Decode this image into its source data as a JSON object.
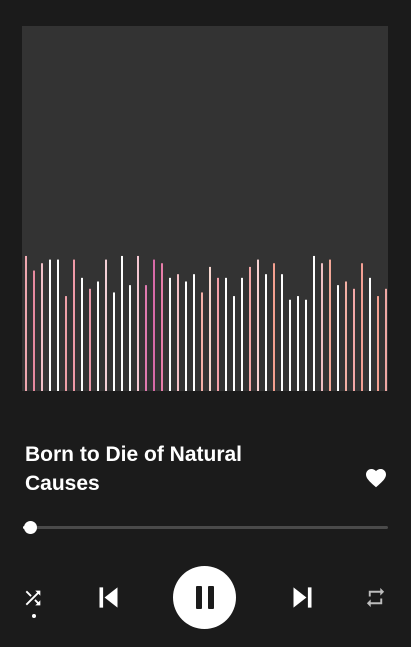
{
  "now_playing": {
    "track_title": "Born to Die of Natural Causes",
    "liked": true,
    "progress_fraction": 0.02
  },
  "visualizer": {
    "bars": [
      {
        "level": 0.37,
        "color": "#f0a8b0"
      },
      {
        "level": 0.33,
        "color": "#e88aa0"
      },
      {
        "level": 0.35,
        "color": "#f2c0c8"
      },
      {
        "level": 0.36,
        "color": "#ffffff"
      },
      {
        "level": 0.36,
        "color": "#ffffff"
      },
      {
        "level": 0.26,
        "color": "#f0a0a8"
      },
      {
        "level": 0.36,
        "color": "#f09aa8"
      },
      {
        "level": 0.31,
        "color": "#ffffff"
      },
      {
        "level": 0.28,
        "color": "#e898a8"
      },
      {
        "level": 0.3,
        "color": "#ffffff"
      },
      {
        "level": 0.36,
        "color": "#f4d0d6"
      },
      {
        "level": 0.27,
        "color": "#ffffff"
      },
      {
        "level": 0.37,
        "color": "#ffffff"
      },
      {
        "level": 0.29,
        "color": "#ffffff"
      },
      {
        "level": 0.37,
        "color": "#f5c8d2"
      },
      {
        "level": 0.29,
        "color": "#e07ab0"
      },
      {
        "level": 0.36,
        "color": "#d86aa8"
      },
      {
        "level": 0.35,
        "color": "#e87eaa"
      },
      {
        "level": 0.31,
        "color": "#ffffff"
      },
      {
        "level": 0.32,
        "color": "#f4c0c6"
      },
      {
        "level": 0.3,
        "color": "#ffffff"
      },
      {
        "level": 0.32,
        "color": "#ffffff"
      },
      {
        "level": 0.27,
        "color": "#f5b0a8"
      },
      {
        "level": 0.34,
        "color": "#f8d8d0"
      },
      {
        "level": 0.31,
        "color": "#f4a0a8"
      },
      {
        "level": 0.31,
        "color": "#ffffff"
      },
      {
        "level": 0.26,
        "color": "#ffffff"
      },
      {
        "level": 0.31,
        "color": "#ffffff"
      },
      {
        "level": 0.34,
        "color": "#f4a8a8"
      },
      {
        "level": 0.36,
        "color": "#f8d4d4"
      },
      {
        "level": 0.32,
        "color": "#ffffff"
      },
      {
        "level": 0.35,
        "color": "#f4a090"
      },
      {
        "level": 0.32,
        "color": "#ffffff"
      },
      {
        "level": 0.25,
        "color": "#ffffff"
      },
      {
        "level": 0.26,
        "color": "#ffffff"
      },
      {
        "level": 0.25,
        "color": "#ffffff"
      },
      {
        "level": 0.37,
        "color": "#ffffff"
      },
      {
        "level": 0.35,
        "color": "#f0c0c4"
      },
      {
        "level": 0.36,
        "color": "#f4a898"
      },
      {
        "level": 0.29,
        "color": "#ffffff"
      },
      {
        "level": 0.3,
        "color": "#f4b0a4"
      },
      {
        "level": 0.28,
        "color": "#f4a8a8"
      },
      {
        "level": 0.35,
        "color": "#f4a094"
      },
      {
        "level": 0.31,
        "color": "#ffffff"
      },
      {
        "level": 0.26,
        "color": "#f4a090"
      },
      {
        "level": 0.28,
        "color": "#f0a8a4"
      }
    ]
  },
  "controls": {
    "shuffle_icon": "shuffle-icon",
    "shuffle_active": true,
    "previous_icon": "skip-previous-icon",
    "play_pause_icon": "pause-icon",
    "next_icon": "skip-next-icon",
    "repeat_icon": "repeat-icon"
  },
  "colors": {
    "background": "#1b1b1b",
    "artwork_background": "#333333",
    "seek_track": "#4a4a4a",
    "foreground": "#ffffff"
  }
}
